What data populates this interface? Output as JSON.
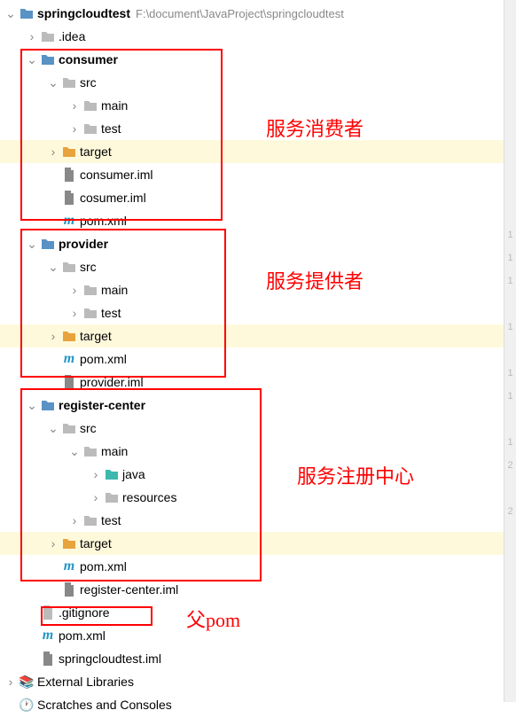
{
  "root": {
    "name": "springcloudtest",
    "path": "F:\\document\\JavaProject\\springcloudtest"
  },
  "idea": ".idea",
  "consumer": {
    "name": "consumer",
    "src": "src",
    "main": "main",
    "test": "test",
    "target": "target",
    "iml1": "consumer.iml",
    "iml2": "cosumer.iml",
    "pom": "pom.xml"
  },
  "provider": {
    "name": "provider",
    "src": "src",
    "main": "main",
    "test": "test",
    "target": "target",
    "pom": "pom.xml",
    "iml": "provider.iml"
  },
  "register": {
    "name": "register-center",
    "src": "src",
    "main": "main",
    "java": "java",
    "resources": "resources",
    "test": "test",
    "target": "target",
    "pom": "pom.xml",
    "iml": "register-center.iml"
  },
  "gitignore": ".gitignore",
  "parentpom": "pom.xml",
  "rootiml": "springcloudtest.iml",
  "extlib": "External Libraries",
  "scratch": "Scratches and Consoles",
  "annotations": {
    "consumer": "服务消费者",
    "provider": "服务提供者",
    "register": "服务注册中心",
    "parentpom": "父pom"
  },
  "gutter": [
    "1",
    "1",
    "1",
    "",
    "1",
    "",
    "1",
    "1",
    "",
    "1",
    "2",
    "",
    "2"
  ]
}
